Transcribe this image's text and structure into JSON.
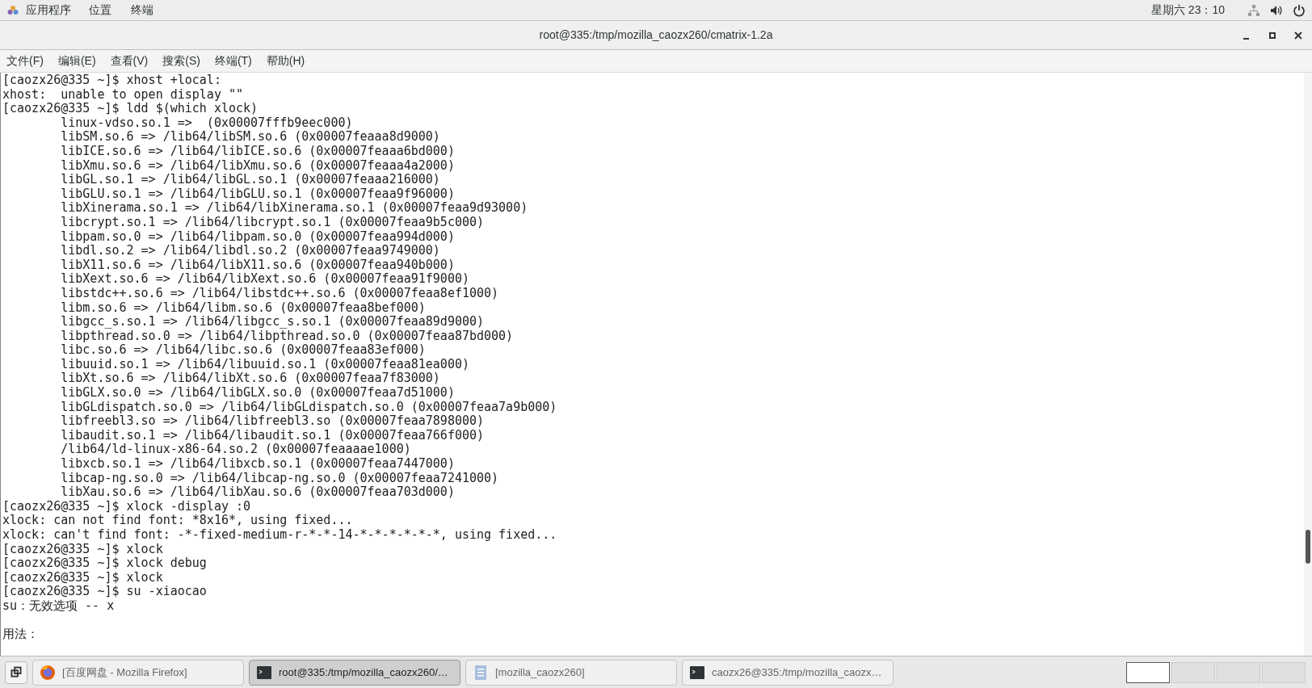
{
  "top_bar": {
    "menus": [
      "应用程序",
      "位置",
      "终端"
    ],
    "clock": "星期六 23：10"
  },
  "window": {
    "title": "root@335:/tmp/mozilla_caozx260/cmatrix-1.2a"
  },
  "menu_bar": [
    "文件(F)",
    "编辑(E)",
    "查看(V)",
    "搜索(S)",
    "终端(T)",
    "帮助(H)"
  ],
  "terminal": {
    "lines": [
      {
        "kind": "text",
        "text": "[caozx26@335 ~]$ xhost +local:"
      },
      {
        "kind": "text",
        "text": "xhost:  unable to open display \"\""
      },
      {
        "kind": "text",
        "text": "[caozx26@335 ~]$ ldd $(which xlock)"
      },
      {
        "kind": "text",
        "text": "        linux-vdso.so.1 =>  (0x00007fffb9eec000)"
      },
      {
        "kind": "text",
        "text": "        libSM.so.6 => /lib64/libSM.so.6 (0x00007feaaa8d9000)"
      },
      {
        "kind": "text",
        "text": "        libICE.so.6 => /lib64/libICE.so.6 (0x00007feaaa6bd000)"
      },
      {
        "kind": "text",
        "text": "        libXmu.so.6 => /lib64/libXmu.so.6 (0x00007feaaa4a2000)"
      },
      {
        "kind": "text",
        "text": "        libGL.so.1 => /lib64/libGL.so.1 (0x00007feaaa216000)"
      },
      {
        "kind": "text",
        "text": "        libGLU.so.1 => /lib64/libGLU.so.1 (0x00007feaa9f96000)"
      },
      {
        "kind": "text",
        "text": "        libXinerama.so.1 => /lib64/libXinerama.so.1 (0x00007feaa9d93000)"
      },
      {
        "kind": "text",
        "text": "        libcrypt.so.1 => /lib64/libcrypt.so.1 (0x00007feaa9b5c000)"
      },
      {
        "kind": "text",
        "text": "        libpam.so.0 => /lib64/libpam.so.0 (0x00007feaa994d000)"
      },
      {
        "kind": "text",
        "text": "        libdl.so.2 => /lib64/libdl.so.2 (0x00007feaa9749000)"
      },
      {
        "kind": "text",
        "text": "        libX11.so.6 => /lib64/libX11.so.6 (0x00007feaa940b000)"
      },
      {
        "kind": "text",
        "text": "        libXext.so.6 => /lib64/libXext.so.6 (0x00007feaa91f9000)"
      },
      {
        "kind": "text",
        "text": "        libstdc++.so.6 => /lib64/libstdc++.so.6 (0x00007feaa8ef1000)"
      },
      {
        "kind": "text",
        "text": "        libm.so.6 => /lib64/libm.so.6 (0x00007feaa8bef000)"
      },
      {
        "kind": "text",
        "text": "        libgcc_s.so.1 => /lib64/libgcc_s.so.1 (0x00007feaa89d9000)"
      },
      {
        "kind": "text",
        "text": "        libpthread.so.0 => /lib64/libpthread.so.0 (0x00007feaa87bd000)"
      },
      {
        "kind": "text",
        "text": "        libc.so.6 => /lib64/libc.so.6 (0x00007feaa83ef000)"
      },
      {
        "kind": "text",
        "text": "        libuuid.so.1 => /lib64/libuuid.so.1 (0x00007feaa81ea000)"
      },
      {
        "kind": "text",
        "text": "        libXt.so.6 => /lib64/libXt.so.6 (0x00007feaa7f83000)"
      },
      {
        "kind": "text",
        "text": "        libGLX.so.0 => /lib64/libGLX.so.0 (0x00007feaa7d51000)"
      },
      {
        "kind": "text",
        "text": "        libGLdispatch.so.0 => /lib64/libGLdispatch.so.0 (0x00007feaa7a9b000)"
      },
      {
        "kind": "text",
        "text": "        libfreebl3.so => /lib64/libfreebl3.so (0x00007feaa7898000)"
      },
      {
        "kind": "text",
        "text": "        libaudit.so.1 => /lib64/libaudit.so.1 (0x00007feaa766f000)"
      },
      {
        "kind": "text",
        "text": "        /lib64/ld-linux-x86-64.so.2 (0x00007feaaaae1000)"
      },
      {
        "kind": "text",
        "text": "        libxcb.so.1 => /lib64/libxcb.so.1 (0x00007feaa7447000)"
      },
      {
        "kind": "text",
        "text": "        libcap-ng.so.0 => /lib64/libcap-ng.so.0 (0x00007feaa7241000)"
      },
      {
        "kind": "text",
        "text": "        libXau.so.6 => /lib64/libXau.so.6 (0x00007feaa703d000)"
      },
      {
        "kind": "text",
        "text": "[caozx26@335 ~]$ xlock -display :0"
      },
      {
        "kind": "text",
        "text": "xlock: can not find font: *8x16*, using fixed..."
      },
      {
        "kind": "text",
        "text": "xlock: can't find font: -*-fixed-medium-r-*-*-14-*-*-*-*-*-*, using fixed..."
      },
      {
        "kind": "text",
        "text": "[caozx26@335 ~]$ xlock"
      },
      {
        "kind": "text",
        "text": "[caozx26@335 ~]$ xlock debug"
      },
      {
        "kind": "text",
        "text": "[caozx26@335 ~]$ xlock"
      },
      {
        "kind": "text",
        "text": "[caozx26@335 ~]$ su -xiaocao"
      },
      {
        "kind": "text",
        "text": "su：无效选项 -- x"
      },
      {
        "kind": "blank"
      },
      {
        "kind": "text",
        "text": "用法："
      }
    ]
  },
  "taskbar": {
    "tasks": [
      {
        "kind": "browser",
        "label": "[百度网盘 - Mozilla Firefox]",
        "selected": false
      },
      {
        "kind": "terminal",
        "label": "root@335:/tmp/mozilla_caozx260/…",
        "selected": true
      },
      {
        "kind": "document",
        "label": "[mozilla_caozx260]",
        "selected": false
      },
      {
        "kind": "terminal",
        "label": "caozx26@335:/tmp/mozilla_caozx…",
        "selected": false
      }
    ],
    "workspaces": [
      {
        "selected": true
      },
      {
        "selected": false
      },
      {
        "selected": false
      },
      {
        "selected": false
      }
    ]
  }
}
